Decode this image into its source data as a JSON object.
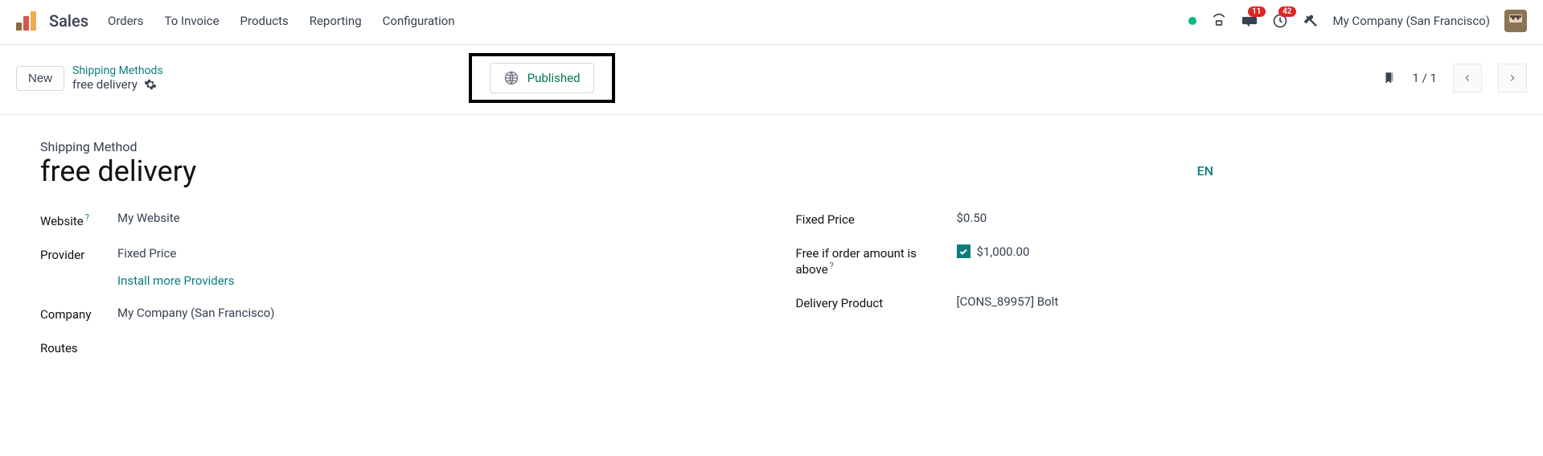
{
  "app": {
    "name": "Sales"
  },
  "nav": {
    "items": [
      {
        "label": "Orders"
      },
      {
        "label": "To Invoice"
      },
      {
        "label": "Products"
      },
      {
        "label": "Reporting"
      },
      {
        "label": "Configuration"
      }
    ]
  },
  "topbar": {
    "messages_badge": "11",
    "activities_badge": "42",
    "company": "My Company (San Francisco)"
  },
  "subbar": {
    "new_label": "New",
    "breadcrumb_parent": "Shipping Methods",
    "breadcrumb_current": "free delivery",
    "published_label": "Published",
    "pager": "1 / 1"
  },
  "form": {
    "section_label": "Shipping Method",
    "title": "free delivery",
    "lang": "EN",
    "left": {
      "website_label": "Website",
      "website_value": "My Website",
      "provider_label": "Provider",
      "provider_value": "Fixed Price",
      "install_more": "Install more Providers",
      "company_label": "Company",
      "company_value": "My Company (San Francisco)",
      "routes_label": "Routes"
    },
    "right": {
      "fixed_price_label": "Fixed Price",
      "fixed_price_value": "$0.50",
      "free_if_label": "Free if order amount is above",
      "free_if_value": "$1,000.00",
      "free_if_checked": true,
      "delivery_product_label": "Delivery Product",
      "delivery_product_value": "[CONS_89957] Bolt"
    }
  }
}
